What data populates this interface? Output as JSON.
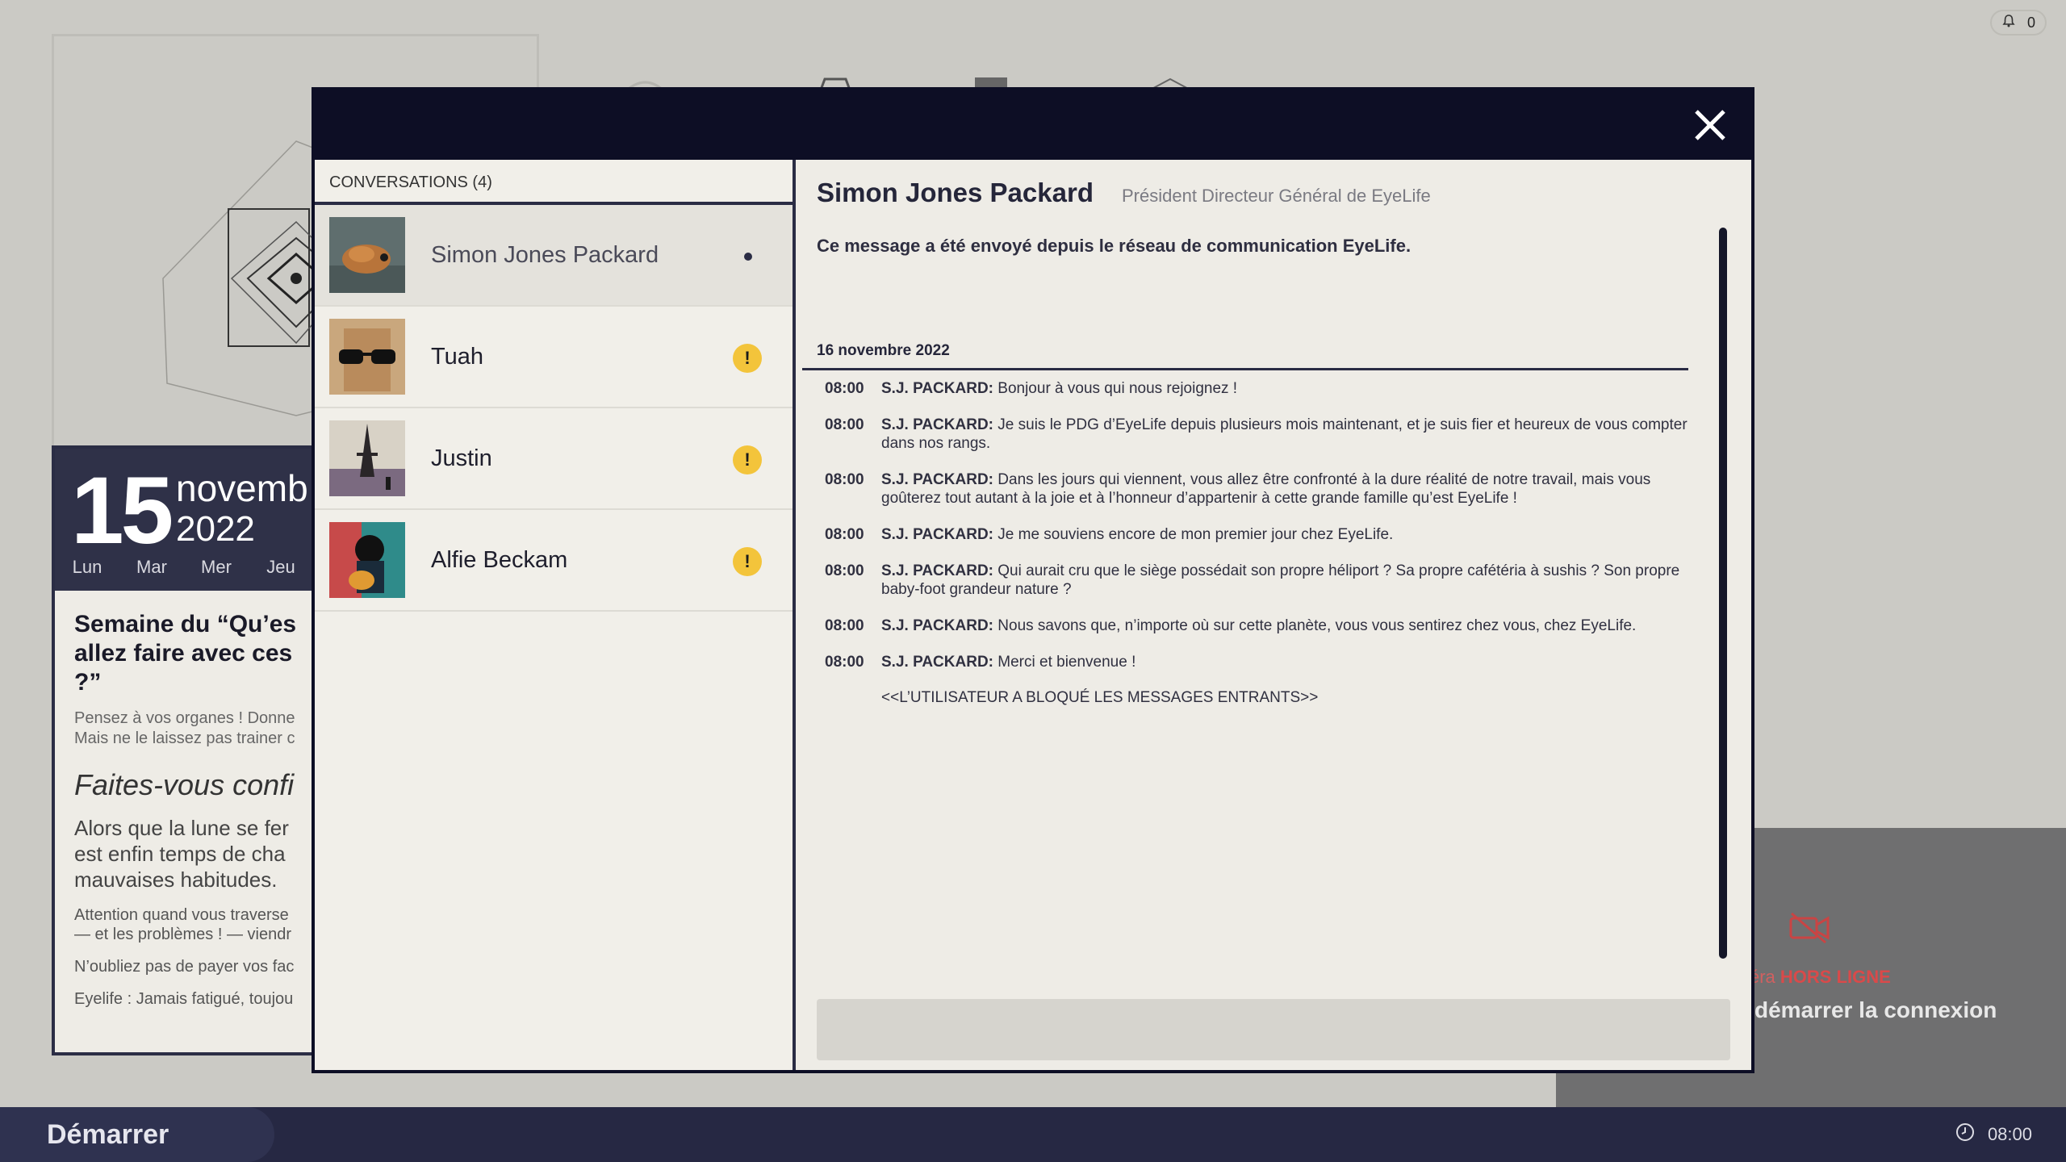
{
  "notifications": {
    "count": "0",
    "icon": "bell-icon"
  },
  "calendar": {
    "day": "15",
    "month": "novemb",
    "year": "2022",
    "weekdays": [
      "Lun",
      "Mar",
      "Mer",
      "Jeu"
    ],
    "title": "Semaine du “Qu’es\nallez faire avec ces\n?”",
    "subtitle": "Pensez à vos organes ! Donne\nMais ne le laissez pas trainer c",
    "italic_heading": "Faites-vous confi",
    "paragraph": "Alors que la lune se fer\nest enfin temps de cha\nmauvaises habitudes.",
    "note1": "Attention quand vous traverse\n— et les problèmes ! — viendr",
    "note2": "N’oubliez pas de payer vos fac",
    "note3": "Eyelife : Jamais fatigué, toujou"
  },
  "offline_panel": {
    "status_prefix": "éra",
    "status": "HORS LIGNE",
    "action": "démarrer la connexion",
    "icon": "camera-off-icon"
  },
  "taskbar": {
    "start_label": "Démarrer",
    "time": "08:00",
    "clock_icon": "clock-icon"
  },
  "modal": {
    "close_icon": "close-icon",
    "conversations_header": "CONVERSATIONS (4)",
    "conversations": [
      {
        "name": "Simon Jones Packard",
        "status": "read",
        "active": true
      },
      {
        "name": "Tuah",
        "status": "alert",
        "badge": "!"
      },
      {
        "name": "Justin",
        "status": "alert",
        "badge": "!"
      },
      {
        "name": "Alfie Beckam",
        "status": "alert",
        "badge": "!"
      }
    ],
    "chat": {
      "contact_name": "Simon Jones Packard",
      "contact_role": "Président Directeur Général de EyeLife",
      "network_note": "Ce message a été envoyé depuis le réseau de communication EyeLife.",
      "date": "16 novembre 2022",
      "messages": [
        {
          "time": "08:00",
          "author": "S.J. PACKARD:",
          "text": "Bonjour à vous qui nous rejoignez !"
        },
        {
          "time": "08:00",
          "author": "S.J. PACKARD:",
          "text": "Je suis le PDG d’EyeLife depuis plusieurs mois maintenant, et je suis fier et heureux de vous compter dans nos rangs."
        },
        {
          "time": "08:00",
          "author": "S.J. PACKARD:",
          "text": "Dans les jours qui viennent, vous allez être confronté à la dure réalité de notre travail, mais vous goûterez tout autant à la joie et à l’honneur d’appartenir à cette grande famille qu’est EyeLife !"
        },
        {
          "time": "08:00",
          "author": "S.J. PACKARD:",
          "text": "Je me souviens encore de mon premier jour chez EyeLife."
        },
        {
          "time": "08:00",
          "author": "S.J. PACKARD:",
          "text": "Qui aurait cru que le siège possédait son propre héliport ? Sa propre cafétéria à sushis ? Son propre baby-foot grandeur nature ?"
        },
        {
          "time": "08:00",
          "author": "S.J. PACKARD:",
          "text": "Nous savons que, n’importe où sur cette planète, vous vous sentirez chez vous, chez EyeLife."
        },
        {
          "time": "08:00",
          "author": "S.J. PACKARD:",
          "text": "Merci et bienvenue !"
        }
      ],
      "blocked_notice": "<<L’UTILISATEUR A BLOQUÉ LES MESSAGES ENTRANTS>>",
      "input_placeholder": ""
    }
  }
}
